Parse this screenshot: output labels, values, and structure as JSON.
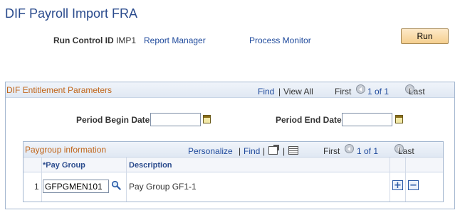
{
  "page": {
    "title": "DIF Payroll Import FRA"
  },
  "run_control": {
    "label": "Run Control ID",
    "value": "IMP1",
    "report_manager": "Report Manager",
    "process_monitor": "Process Monitor",
    "run_label": "Run"
  },
  "entitlement": {
    "title": "DIF Entitlement Parameters",
    "find": "Find",
    "separator": "|",
    "view_all": "View All",
    "first": "First",
    "count": "1 of 1",
    "last": "Last",
    "period_begin_label": "Period Begin Date",
    "period_begin_value": "",
    "period_end_label": "Period End Date",
    "period_end_value": ""
  },
  "paygroup": {
    "title": "Paygroup information",
    "personalize": "Personalize",
    "separator": "|",
    "find": "Find",
    "first": "First",
    "count": "1 of 1",
    "last": "Last",
    "columns": {
      "pay_group": "*Pay Group",
      "description": "Description"
    },
    "rows": [
      {
        "num": "1",
        "pay_group": "GFPGMEN101",
        "description": "Pay Group GF1-1"
      }
    ],
    "add_label": "+",
    "delete_label": "−"
  },
  "colors": {
    "title": "#2a4b8d",
    "section_title": "#c0651a",
    "link": "#1f4a9c",
    "run_button": "#f5cf8f"
  },
  "icons": [
    "calendar-icon",
    "search-icon",
    "prev-icon",
    "next-icon",
    "zoom-icon",
    "download-grid-icon",
    "add-row-icon",
    "delete-row-icon"
  ]
}
